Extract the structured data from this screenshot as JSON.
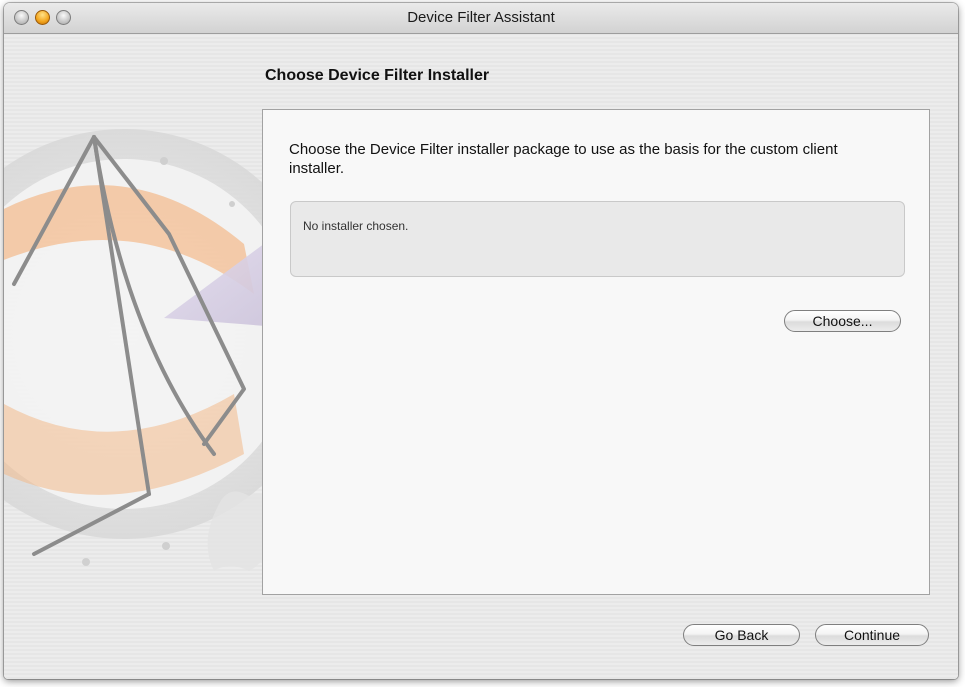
{
  "window": {
    "title": "Device Filter Assistant"
  },
  "step": {
    "title": "Choose Device Filter Installer",
    "instructions": "Choose the Device Filter installer package to use as the basis for the custom client installer.",
    "chosen_installer_text": "No installer chosen.",
    "choose_button_label": "Choose..."
  },
  "footer": {
    "go_back_label": "Go Back",
    "continue_label": "Continue"
  },
  "icons": {
    "window_controls": [
      "close-icon",
      "minimize-icon",
      "zoom-icon"
    ],
    "background_art": "assistant-pyramid-icon"
  },
  "colors": {
    "minimize_button": "#f2a41c",
    "art_accent": "#f3b98a",
    "panel_background": "#f8f8f8"
  }
}
